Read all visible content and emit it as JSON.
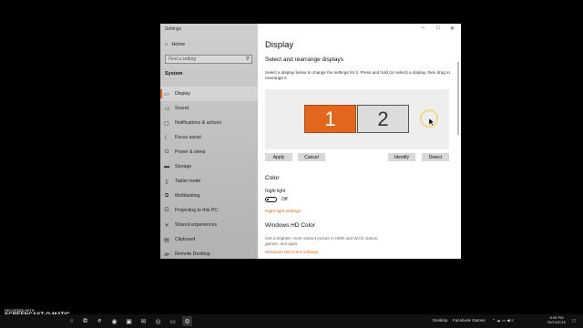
{
  "window": {
    "app_title": "Settings",
    "controls": {
      "minimize": "–",
      "maximize": "□",
      "close": "✕"
    }
  },
  "sidebar": {
    "home_label": "Home",
    "search_placeholder": "Find a setting",
    "section_label": "System",
    "items": [
      {
        "label": "Display",
        "icon": "monitor-icon",
        "active": true
      },
      {
        "label": "Sound",
        "icon": "speaker-icon"
      },
      {
        "label": "Notifications & actions",
        "icon": "notification-icon"
      },
      {
        "label": "Focus assist",
        "icon": "moon-icon"
      },
      {
        "label": "Power & sleep",
        "icon": "power-icon"
      },
      {
        "label": "Storage",
        "icon": "storage-icon"
      },
      {
        "label": "Tablet mode",
        "icon": "tablet-icon"
      },
      {
        "label": "Multitasking",
        "icon": "multitasking-icon"
      },
      {
        "label": "Projecting to this PC",
        "icon": "projector-icon"
      },
      {
        "label": "Shared experiences",
        "icon": "share-icon"
      },
      {
        "label": "Clipboard",
        "icon": "clipboard-icon"
      },
      {
        "label": "Remote Desktop",
        "icon": "remote-icon"
      }
    ]
  },
  "main": {
    "title": "Display",
    "subtitle": "Select and rearrange displays",
    "description": "Select a display below to change the settings for it. Press and hold (or select) a display, then drag to rearrange it.",
    "monitors": [
      "1",
      "2"
    ],
    "buttons": {
      "apply": "Apply",
      "cancel": "Cancel",
      "identify": "Identify",
      "detect": "Detect"
    },
    "color_heading": "Color",
    "night_light_label": "Night light",
    "night_light_state": "Off",
    "night_light_link": "Night light settings",
    "hd_heading": "Windows HD Color",
    "hd_description": "Get a brighter, more vibrant picture in HDR and WCG videos, games, and apps.",
    "hd_link": "Windows HD Color settings"
  },
  "watermark": {
    "line1": "RECORDED WITH",
    "line2": "SCREENCAST-O-MATIC"
  },
  "taskbar": {
    "desktop_label": "Desktop",
    "facebook_label": "Facebook Games",
    "time": "8:05 PM",
    "date": "05/13/2019"
  },
  "colors": {
    "accent": "#e2661c",
    "sidebar": "#c4c4c4",
    "background": "#000000"
  }
}
